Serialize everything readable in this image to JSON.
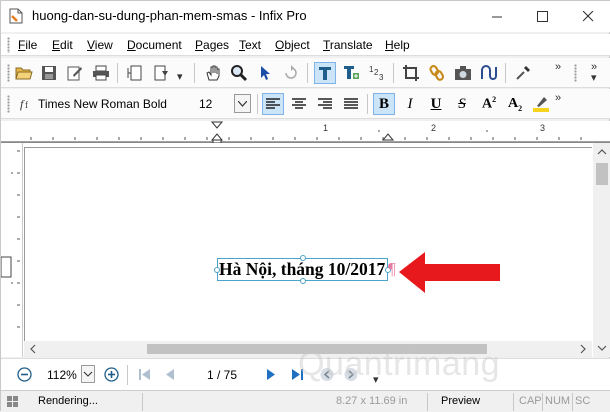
{
  "window": {
    "title": "huong-dan-su-dung-phan-mem-smas - Infix Pro"
  },
  "menu": {
    "items": [
      {
        "label": "File",
        "ul": "F",
        "rest": "ile"
      },
      {
        "label": "Edit",
        "ul": "E",
        "rest": "dit"
      },
      {
        "label": "View",
        "ul": "V",
        "rest": "iew"
      },
      {
        "label": "Document",
        "ul": "D",
        "rest": "ocument"
      },
      {
        "label": "Pages",
        "ul": "P",
        "rest": "ages"
      },
      {
        "label": "Text",
        "ul": "T",
        "rest": "ext"
      },
      {
        "label": "Object",
        "ul": "O",
        "rest": "bject"
      },
      {
        "label": "Translate",
        "ul": "T",
        "rest": "ranslate"
      },
      {
        "label": "Help",
        "ul": "H",
        "rest": "elp"
      }
    ]
  },
  "format_toolbar": {
    "font_name": "Times New Roman Bold",
    "font_size": "12"
  },
  "ruler": {
    "numbers": [
      "1",
      "2",
      "3"
    ]
  },
  "document": {
    "text": "Hà Nội, tháng 10/2017",
    "pilcrow": "¶"
  },
  "navigation": {
    "zoom": "112%",
    "page_indicator": "1 / 75"
  },
  "status": {
    "rendering": "Rendering...",
    "page_size": "8.27 x 11.69 in",
    "mode": "Preview",
    "cap": "CAP",
    "num": "NUM",
    "scroll": "SC"
  },
  "watermark": "Quantrimang",
  "colors": {
    "accent_arrow": "#e8191c",
    "selection_border": "#4aa3c9",
    "active_button": "#cce4f7"
  }
}
